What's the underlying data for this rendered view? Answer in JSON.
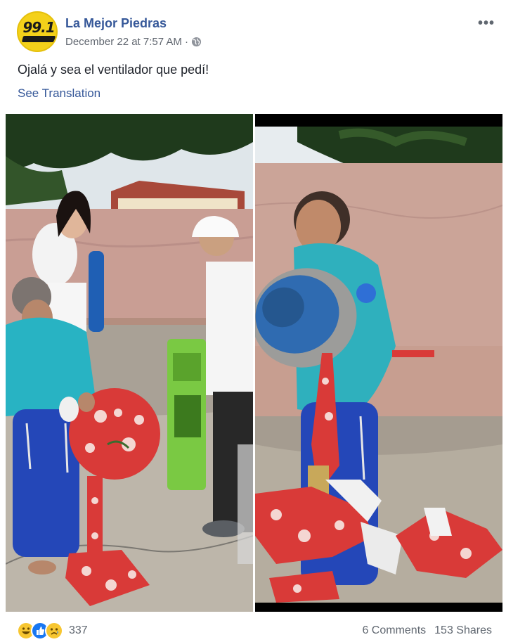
{
  "post": {
    "page_name": "La Mejor Piedras",
    "avatar_text": "99.1",
    "timestamp": "December 22 at 7:57 AM",
    "separator": "·",
    "text": "Ojalá y sea el ventilador que pedí!",
    "see_translation": "See Translation"
  },
  "footer": {
    "reaction_count": "337",
    "comments": "6 Comments",
    "shares": "153 Shares"
  },
  "reactions": [
    "haha-icon",
    "like-icon",
    "sad-icon"
  ],
  "colors": {
    "link": "#365899",
    "text": "#1d2129",
    "meta": "#616770",
    "brand_yellow": "#f4d11a",
    "like_blue": "#1877f2"
  }
}
